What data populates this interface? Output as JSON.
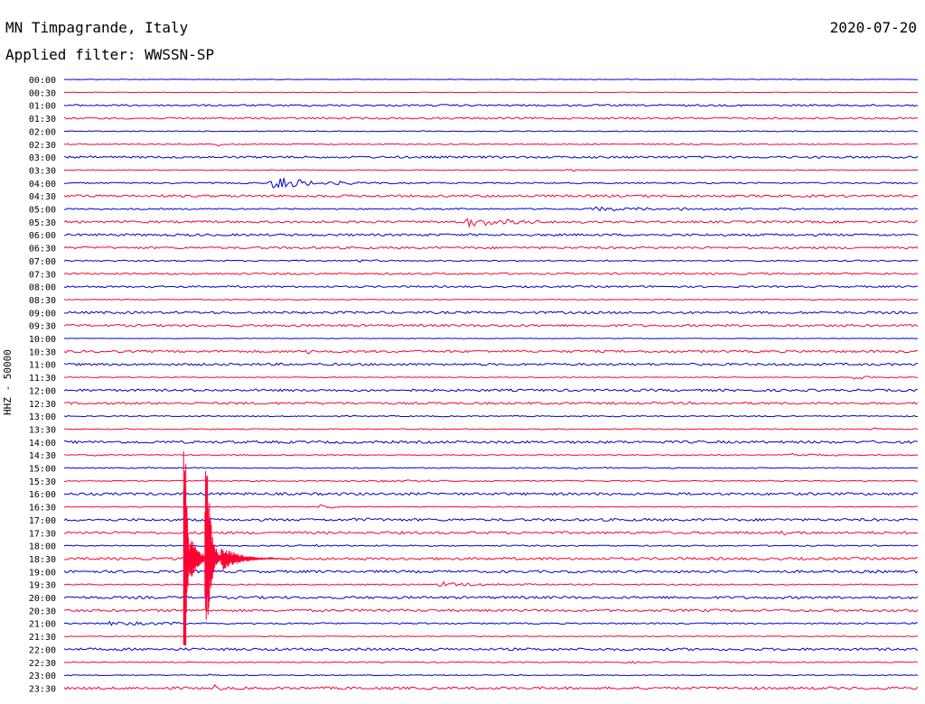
{
  "header": {
    "title": "MN Timpagrande, Italy",
    "date": "2020-07-20",
    "filter": "Applied filter: WWSSN-SP"
  },
  "station_axis_label": "HHZ - 50000",
  "colors": {
    "blue": "#0000cc",
    "red": "#ff0033",
    "text": "#000000"
  },
  "chart_data": {
    "type": "line",
    "title": "MN Timpagrande, Italy",
    "subtitle": "Applied filter: WWSSN-SP",
    "ylabel": "HHZ - 50000",
    "traces": [
      {
        "time": "00:00",
        "color": "blue",
        "amp": 0.3,
        "events": []
      },
      {
        "time": "00:30",
        "color": "red",
        "amp": 0.3,
        "events": []
      },
      {
        "time": "01:00",
        "color": "blue",
        "amp": 1.0,
        "events": []
      },
      {
        "time": "01:30",
        "color": "red",
        "amp": 1.0,
        "events": []
      },
      {
        "time": "02:00",
        "color": "blue",
        "amp": 0.5,
        "events": []
      },
      {
        "time": "02:30",
        "color": "red",
        "amp": 0.6,
        "events": [
          {
            "t": 0.18,
            "a": 3,
            "d": 0.003
          }
        ]
      },
      {
        "time": "03:00",
        "color": "blue",
        "amp": 1.2,
        "events": []
      },
      {
        "time": "03:30",
        "color": "red",
        "amp": 0.5,
        "events": [
          {
            "t": 0.59,
            "a": 2,
            "d": 0.01
          }
        ]
      },
      {
        "time": "04:00",
        "color": "blue",
        "amp": 0.8,
        "events": [
          {
            "t": 0.242,
            "a": 7,
            "d": 0.05
          }
        ]
      },
      {
        "time": "04:30",
        "color": "red",
        "amp": 1.3,
        "events": []
      },
      {
        "time": "05:00",
        "color": "blue",
        "amp": 0.8,
        "events": [
          {
            "t": 0.62,
            "a": 2,
            "d": 0.15
          }
        ]
      },
      {
        "time": "05:30",
        "color": "red",
        "amp": 1.2,
        "events": [
          {
            "t": 0.47,
            "a": 5,
            "d": 0.06
          }
        ]
      },
      {
        "time": "06:00",
        "color": "blue",
        "amp": 1.3,
        "events": []
      },
      {
        "time": "06:30",
        "color": "red",
        "amp": 1.2,
        "events": []
      },
      {
        "time": "07:00",
        "color": "blue",
        "amp": 0.7,
        "events": [
          {
            "t": 0.34,
            "a": 2,
            "d": 0.02
          }
        ]
      },
      {
        "time": "07:30",
        "color": "red",
        "amp": 1.0,
        "events": []
      },
      {
        "time": "08:00",
        "color": "blue",
        "amp": 1.0,
        "events": [
          {
            "t": 0.1,
            "a": 3,
            "d": 0.004
          }
        ]
      },
      {
        "time": "08:30",
        "color": "red",
        "amp": 0.5,
        "events": []
      },
      {
        "time": "09:00",
        "color": "blue",
        "amp": 1.3,
        "events": []
      },
      {
        "time": "09:30",
        "color": "red",
        "amp": 1.3,
        "events": []
      },
      {
        "time": "10:00",
        "color": "blue",
        "amp": 0.3,
        "events": []
      },
      {
        "time": "10:30",
        "color": "red",
        "amp": 1.3,
        "events": [
          {
            "t": 0.28,
            "a": 3,
            "d": 0.01
          }
        ]
      },
      {
        "time": "11:00",
        "color": "blue",
        "amp": 1.3,
        "events": []
      },
      {
        "time": "11:30",
        "color": "red",
        "amp": 0.5,
        "events": [
          {
            "t": 0.92,
            "a": 3,
            "d": 0.02
          },
          {
            "t": 0.04,
            "a": 2,
            "d": 0.003
          }
        ]
      },
      {
        "time": "12:00",
        "color": "blue",
        "amp": 1.3,
        "events": []
      },
      {
        "time": "12:30",
        "color": "red",
        "amp": 1.3,
        "events": []
      },
      {
        "time": "13:00",
        "color": "blue",
        "amp": 0.6,
        "events": [
          {
            "t": 0.82,
            "a": 2,
            "d": 0.01
          },
          {
            "t": 0.46,
            "a": 1.5,
            "d": 0.004
          }
        ]
      },
      {
        "time": "13:30",
        "color": "red",
        "amp": 0.6,
        "events": [
          {
            "t": 0.94,
            "a": 2,
            "d": 0.02
          }
        ]
      },
      {
        "time": "14:00",
        "color": "blue",
        "amp": 1.4,
        "events": []
      },
      {
        "time": "14:30",
        "color": "red",
        "amp": 0.6,
        "events": [
          {
            "t": 0.85,
            "a": 3,
            "d": 0.03
          },
          {
            "t": 0.04,
            "a": 3,
            "d": 0.004
          }
        ]
      },
      {
        "time": "15:00",
        "color": "blue",
        "amp": 0.6,
        "events": [
          {
            "t": 0.6,
            "a": 2,
            "d": 0.02
          },
          {
            "t": 0.1,
            "a": 2,
            "d": 0.003
          }
        ]
      },
      {
        "time": "15:30",
        "color": "red",
        "amp": 0.7,
        "events": [
          {
            "t": 0.36,
            "a": 2.5,
            "d": 0.04
          }
        ]
      },
      {
        "time": "16:00",
        "color": "blue",
        "amp": 1.4,
        "events": []
      },
      {
        "time": "16:30",
        "color": "red",
        "amp": 0.5,
        "events": [
          {
            "t": 0.3,
            "a": 2,
            "d": 0.02
          }
        ]
      },
      {
        "time": "17:00",
        "color": "blue",
        "amp": 1.4,
        "events": [
          {
            "t": 0.34,
            "a": 3,
            "d": 0.01
          }
        ]
      },
      {
        "time": "17:30",
        "color": "red",
        "amp": 1.4,
        "events": [
          {
            "t": 0.84,
            "a": 3,
            "d": 0.01
          }
        ]
      },
      {
        "time": "18:00",
        "color": "blue",
        "amp": 0.7,
        "events": [
          {
            "t": 0.29,
            "a": 2,
            "d": 0.01
          }
        ]
      },
      {
        "time": "18:30",
        "color": "red",
        "amp": 1.4,
        "events": []
      },
      {
        "time": "19:00",
        "color": "blue",
        "amp": 1.4,
        "events": []
      },
      {
        "time": "19:30",
        "color": "red",
        "amp": 0.7,
        "events": [
          {
            "t": 0.44,
            "a": 3,
            "d": 0.05
          }
        ]
      },
      {
        "time": "20:00",
        "color": "blue",
        "amp": 1.4,
        "events": []
      },
      {
        "time": "20:30",
        "color": "red",
        "amp": 1.4,
        "events": [
          {
            "t": 0.38,
            "a": 2,
            "d": 0.003
          }
        ]
      },
      {
        "time": "21:00",
        "color": "blue",
        "amp": 0.8,
        "events": [
          {
            "t": 0.05,
            "a": 2,
            "d": 0.1
          }
        ]
      },
      {
        "time": "21:30",
        "color": "red",
        "amp": 0.5,
        "events": []
      },
      {
        "time": "22:00",
        "color": "blue",
        "amp": 1.4,
        "events": []
      },
      {
        "time": "22:30",
        "color": "red",
        "amp": 0.6,
        "events": [
          {
            "t": 0.66,
            "a": 3,
            "d": 0.006
          }
        ]
      },
      {
        "time": "23:00",
        "color": "blue",
        "amp": 0.5,
        "events": [
          {
            "t": 0.17,
            "a": 2,
            "d": 0.003
          }
        ]
      },
      {
        "time": "23:30",
        "color": "red",
        "amp": 1.4,
        "events": [
          {
            "t": 0.17,
            "a": 5,
            "d": 0.01
          }
        ]
      }
    ],
    "major_event": {
      "color": "red",
      "start_time": "18:30",
      "t": 0.14,
      "peak_down": 120,
      "peak_up": 122,
      "secondary_t": 0.165
    }
  }
}
